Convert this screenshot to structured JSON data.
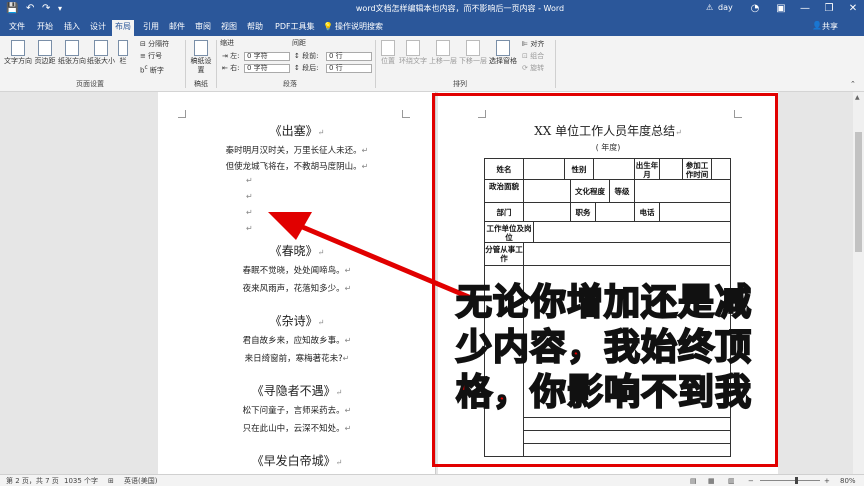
{
  "titlebar": {
    "save_icon": "save-icon",
    "undo_icon": "undo-icon",
    "redo_icon": "redo-icon",
    "title": "word文档怎样编辑本也内容，而不影响后一页内容 - Word",
    "warning": "⚠",
    "user": "day",
    "minimize": "—",
    "restore": "❐",
    "close": "✕",
    "ribbon_options": "▣"
  },
  "tabs": [
    {
      "label": "文件"
    },
    {
      "label": "开始"
    },
    {
      "label": "插入"
    },
    {
      "label": "设计"
    },
    {
      "label": "布局"
    },
    {
      "label": "引用"
    },
    {
      "label": "邮件"
    },
    {
      "label": "审阅"
    },
    {
      "label": "视图"
    },
    {
      "label": "帮助"
    },
    {
      "label": "PDF工具集"
    },
    {
      "label": "操作说明搜索"
    }
  ],
  "share": "共享",
  "ribbon": {
    "text_direction": "文字方向",
    "margins": "页边距",
    "orientation": "纸张方向",
    "size": "纸张大小",
    "columns": "栏",
    "breaks": "分隔符",
    "line_numbers": "行号",
    "hyphenation": "断字",
    "page_setup": "页面设置",
    "draft": "稿纸设置",
    "draft_group": "稿纸",
    "indent": "缩进",
    "spacing": "间距",
    "left": "左:",
    "right": "右:",
    "before": "段前:",
    "after": "段后:",
    "left_val": "0 字符",
    "right_val": "0 字符",
    "before_val": "0 行",
    "after_val": "0 行",
    "paragraph": "段落",
    "position": "位置",
    "wrap": "环绕文字",
    "forward": "上移一层",
    "backward": "下移一层",
    "selection_pane": "选择窗格",
    "align": "对齐",
    "group": "组合",
    "rotate": "旋转",
    "arrange": "排列"
  },
  "page1": {
    "t1": "《出塞》",
    "l1": "秦时明月汉时关，万里长征人未还。",
    "l2": "但使龙城飞将在，不教胡马度阴山。",
    "t2": "《春晓》",
    "l3": "春眠不觉晓，处处闻啼鸟。",
    "l4": "夜来风雨声，花落知多少。",
    "t3": "《杂诗》",
    "l5": "君自故乡来，应知故乡事。",
    "l6": "来日绮窗前，寒梅著花未?",
    "t4": "《寻隐者不遇》",
    "l7": "松下问童子，言师采药去。",
    "l8": "只在此山中，云深不知处。",
    "t5": "《早发白帝城》",
    "mark": "↵"
  },
  "page2": {
    "title": "XX 单位工作人员年度总结",
    "year": "(      年度)",
    "name": "姓名",
    "gender": "性别",
    "birth": "出生年月",
    "work_start": "参加工作时间",
    "politics": "政治面貌",
    "education": "文化程度",
    "grade": "等级",
    "dept": "部门",
    "post": "职务",
    "phone": "电话",
    "unit": "工作单位及岗位",
    "duty": "分管从事工作"
  },
  "overlay": "无论你增加还是减少内容，我始终顶格，你影响不到我",
  "status": {
    "page": "第 2 页，共 7 页",
    "words": "1035 个字",
    "proof": "⊞",
    "lang": "英语(美国)",
    "zoom": "80%"
  }
}
